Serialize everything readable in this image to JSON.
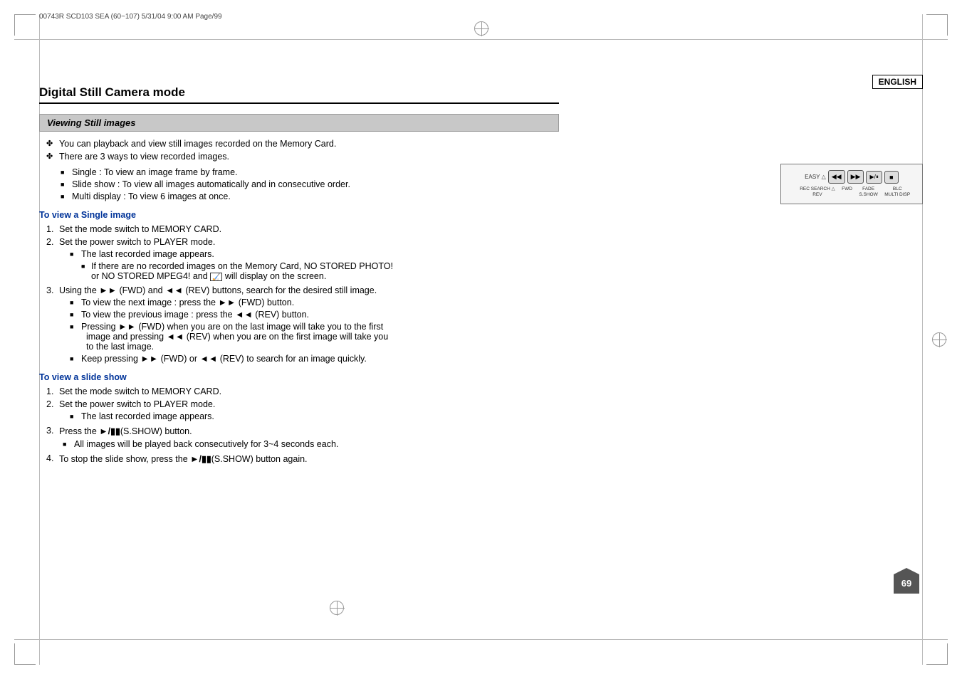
{
  "header": {
    "doc_info": "00743R SCD103 SEA (60~107)   5/31/04  9:00 AM   Page/99",
    "language_badge": "ENGLISH"
  },
  "page": {
    "title": "Digital Still Camera mode",
    "section_header": "Viewing Still images",
    "intro_bullets": [
      "You can playback and view still images recorded on the Memory Card.",
      "There are 3 ways to view recorded images."
    ],
    "view_types": [
      "Single : To view an image frame by frame.",
      "Slide show : To view all images automatically and in consecutive order.",
      "Multi display : To view 6 images at once."
    ],
    "single_image": {
      "heading": "To view a Single image",
      "steps": [
        {
          "text": "Set the mode switch to MEMORY CARD.",
          "sub": []
        },
        {
          "text": "Set the power switch to PLAYER mode.",
          "sub": [
            "The last recorded image appears.",
            "- If there are no recorded images on the Memory Card, NO STORED PHOTO! or NO STORED MPEG4! and 🔲 will display on the screen."
          ]
        },
        {
          "text": "Using the ▶▶ (FWD) and  ◀◀ (REV) buttons, search for the desired still image.",
          "sub": [
            "To view the next image : press the ▶▶ (FWD) button.",
            "To view the previous image : press the ◀◀ (REV) button.",
            "Pressing ▶▶ (FWD) when you are on the last image will take you to the first image and pressing ◀◀ (REV) when you are on the first image will take you to the last image.",
            "Keep pressing ▶▶ (FWD) or  ◀◀ (REV) to search for an image quickly."
          ]
        }
      ]
    },
    "slide_show": {
      "heading": "To view a slide show",
      "steps": [
        {
          "text": "Set the mode switch to MEMORY CARD.",
          "sub": []
        },
        {
          "text": "Set the power switch to PLAYER mode.",
          "sub": [
            "The last recorded image appears."
          ]
        },
        {
          "text": "Press the ▶/⏸ (S.SHOW) button.",
          "sub": []
        },
        {
          "text": "All images will be played back consecutively for 3~4 seconds each.",
          "sub": []
        },
        {
          "text": "To stop the slide show, press the ▶/⏸ (S.SHOW) button again.",
          "sub": []
        }
      ]
    },
    "page_number": "69",
    "camera_diagram": {
      "buttons": [
        {
          "symbol": "◀◀",
          "label": ""
        },
        {
          "symbol": "▶▶",
          "label": ""
        },
        {
          "symbol": "▶/⏸",
          "label": ""
        },
        {
          "symbol": "■",
          "label": ""
        }
      ],
      "labels": [
        {
          "line1": "EASY",
          "line2": ""
        },
        {
          "line1": "REC SEARCH",
          "line2": "REV"
        },
        {
          "line1": "REC SEARCH",
          "line2": "FWD"
        },
        {
          "line1": "FADE",
          "line2": "S.SHOW"
        },
        {
          "line1": "BLC",
          "line2": "MULTI DISP"
        }
      ]
    }
  }
}
